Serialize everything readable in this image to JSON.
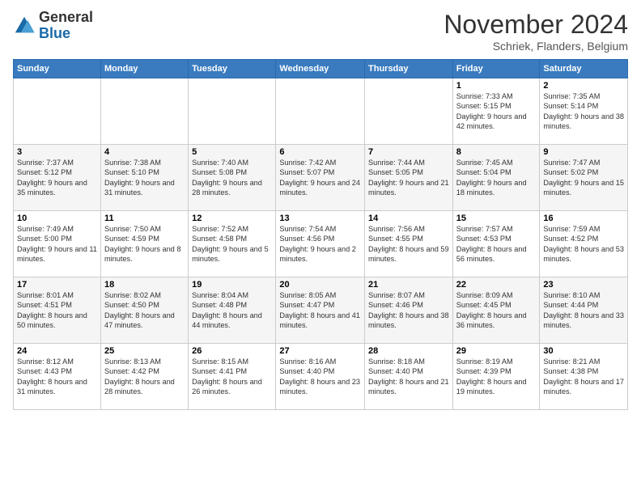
{
  "logo": {
    "text_general": "General",
    "text_blue": "Blue"
  },
  "header": {
    "month_title": "November 2024",
    "location": "Schriek, Flanders, Belgium"
  },
  "weekdays": [
    "Sunday",
    "Monday",
    "Tuesday",
    "Wednesday",
    "Thursday",
    "Friday",
    "Saturday"
  ],
  "weeks": [
    [
      {
        "day": "",
        "info": ""
      },
      {
        "day": "",
        "info": ""
      },
      {
        "day": "",
        "info": ""
      },
      {
        "day": "",
        "info": ""
      },
      {
        "day": "",
        "info": ""
      },
      {
        "day": "1",
        "info": "Sunrise: 7:33 AM\nSunset: 5:15 PM\nDaylight: 9 hours and 42 minutes."
      },
      {
        "day": "2",
        "info": "Sunrise: 7:35 AM\nSunset: 5:14 PM\nDaylight: 9 hours and 38 minutes."
      }
    ],
    [
      {
        "day": "3",
        "info": "Sunrise: 7:37 AM\nSunset: 5:12 PM\nDaylight: 9 hours and 35 minutes."
      },
      {
        "day": "4",
        "info": "Sunrise: 7:38 AM\nSunset: 5:10 PM\nDaylight: 9 hours and 31 minutes."
      },
      {
        "day": "5",
        "info": "Sunrise: 7:40 AM\nSunset: 5:08 PM\nDaylight: 9 hours and 28 minutes."
      },
      {
        "day": "6",
        "info": "Sunrise: 7:42 AM\nSunset: 5:07 PM\nDaylight: 9 hours and 24 minutes."
      },
      {
        "day": "7",
        "info": "Sunrise: 7:44 AM\nSunset: 5:05 PM\nDaylight: 9 hours and 21 minutes."
      },
      {
        "day": "8",
        "info": "Sunrise: 7:45 AM\nSunset: 5:04 PM\nDaylight: 9 hours and 18 minutes."
      },
      {
        "day": "9",
        "info": "Sunrise: 7:47 AM\nSunset: 5:02 PM\nDaylight: 9 hours and 15 minutes."
      }
    ],
    [
      {
        "day": "10",
        "info": "Sunrise: 7:49 AM\nSunset: 5:00 PM\nDaylight: 9 hours and 11 minutes."
      },
      {
        "day": "11",
        "info": "Sunrise: 7:50 AM\nSunset: 4:59 PM\nDaylight: 9 hours and 8 minutes."
      },
      {
        "day": "12",
        "info": "Sunrise: 7:52 AM\nSunset: 4:58 PM\nDaylight: 9 hours and 5 minutes."
      },
      {
        "day": "13",
        "info": "Sunrise: 7:54 AM\nSunset: 4:56 PM\nDaylight: 9 hours and 2 minutes."
      },
      {
        "day": "14",
        "info": "Sunrise: 7:56 AM\nSunset: 4:55 PM\nDaylight: 8 hours and 59 minutes."
      },
      {
        "day": "15",
        "info": "Sunrise: 7:57 AM\nSunset: 4:53 PM\nDaylight: 8 hours and 56 minutes."
      },
      {
        "day": "16",
        "info": "Sunrise: 7:59 AM\nSunset: 4:52 PM\nDaylight: 8 hours and 53 minutes."
      }
    ],
    [
      {
        "day": "17",
        "info": "Sunrise: 8:01 AM\nSunset: 4:51 PM\nDaylight: 8 hours and 50 minutes."
      },
      {
        "day": "18",
        "info": "Sunrise: 8:02 AM\nSunset: 4:50 PM\nDaylight: 8 hours and 47 minutes."
      },
      {
        "day": "19",
        "info": "Sunrise: 8:04 AM\nSunset: 4:48 PM\nDaylight: 8 hours and 44 minutes."
      },
      {
        "day": "20",
        "info": "Sunrise: 8:05 AM\nSunset: 4:47 PM\nDaylight: 8 hours and 41 minutes."
      },
      {
        "day": "21",
        "info": "Sunrise: 8:07 AM\nSunset: 4:46 PM\nDaylight: 8 hours and 38 minutes."
      },
      {
        "day": "22",
        "info": "Sunrise: 8:09 AM\nSunset: 4:45 PM\nDaylight: 8 hours and 36 minutes."
      },
      {
        "day": "23",
        "info": "Sunrise: 8:10 AM\nSunset: 4:44 PM\nDaylight: 8 hours and 33 minutes."
      }
    ],
    [
      {
        "day": "24",
        "info": "Sunrise: 8:12 AM\nSunset: 4:43 PM\nDaylight: 8 hours and 31 minutes."
      },
      {
        "day": "25",
        "info": "Sunrise: 8:13 AM\nSunset: 4:42 PM\nDaylight: 8 hours and 28 minutes."
      },
      {
        "day": "26",
        "info": "Sunrise: 8:15 AM\nSunset: 4:41 PM\nDaylight: 8 hours and 26 minutes."
      },
      {
        "day": "27",
        "info": "Sunrise: 8:16 AM\nSunset: 4:40 PM\nDaylight: 8 hours and 23 minutes."
      },
      {
        "day": "28",
        "info": "Sunrise: 8:18 AM\nSunset: 4:40 PM\nDaylight: 8 hours and 21 minutes."
      },
      {
        "day": "29",
        "info": "Sunrise: 8:19 AM\nSunset: 4:39 PM\nDaylight: 8 hours and 19 minutes."
      },
      {
        "day": "30",
        "info": "Sunrise: 8:21 AM\nSunset: 4:38 PM\nDaylight: 8 hours and 17 minutes."
      }
    ]
  ]
}
